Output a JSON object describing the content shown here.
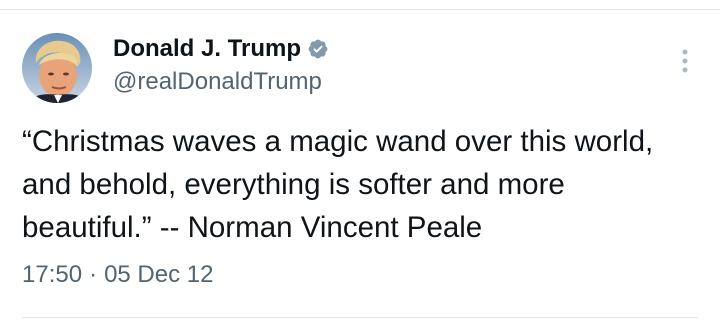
{
  "tweet": {
    "author": {
      "display_name": "Donald J. Trump",
      "handle": "@realDonaldTrump",
      "verified": true
    },
    "text": "“Christmas waves a magic wand over this world, and behold, everything is softer and more beautiful.” -- Norman Vincent Peale",
    "time": "17:50",
    "separator": "·",
    "date": "05 Dec 12"
  },
  "colors": {
    "text_primary": "#0f1419",
    "text_secondary": "#536471",
    "verified_badge": "#829aab",
    "divider": "#e6e9ec"
  },
  "icons": [
    "verified-badge-icon",
    "more-options-icon"
  ]
}
